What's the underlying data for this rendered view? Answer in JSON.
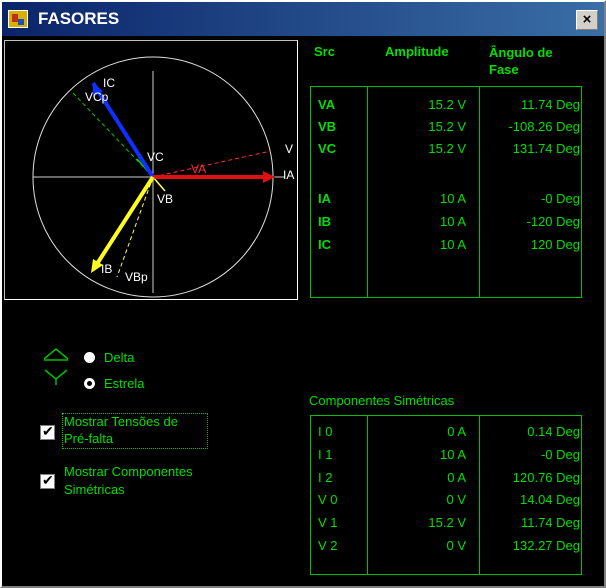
{
  "window": {
    "title": "FASORES",
    "close": "×"
  },
  "phasor_labels": {
    "ic": "IC",
    "vcp": "VCp",
    "vc": "VC",
    "va": "VA",
    "va_edge": "V",
    "ia": "IA",
    "vb": "VB",
    "ib": "IB",
    "vbp": "VBp"
  },
  "table": {
    "headers": {
      "src": "Src",
      "amplitude": "Amplitude",
      "angle": "Ângulo de Fase"
    },
    "rows": [
      {
        "src": "VA",
        "amp": "15.2 V",
        "angle": "11.74  Deg"
      },
      {
        "src": "VB",
        "amp": "15.2 V",
        "angle": "-108.26  Deg"
      },
      {
        "src": "VC",
        "amp": "15.2 V",
        "angle": "131.74  Deg"
      },
      {
        "src": "IA",
        "amp": "10 A",
        "angle": "-0  Deg"
      },
      {
        "src": "IB",
        "amp": "10 A",
        "angle": "-120  Deg"
      },
      {
        "src": "IC",
        "amp": "10 A",
        "angle": "120  Deg"
      }
    ]
  },
  "connection": {
    "delta": "Delta",
    "estrela": "Estrela",
    "selected": "Delta"
  },
  "options": {
    "prefault": {
      "label_line1": "Mostrar Tensões de",
      "label_line2": "Pré-falta",
      "checked": true
    },
    "symmetric": {
      "label_line1": "Mostrar Componentes",
      "label_line2": "Simétricas",
      "checked": true
    }
  },
  "symmetric": {
    "title": "Componentes Simétricas",
    "rows": [
      {
        "src": "I 0",
        "amp": "0 A",
        "angle": "0.14  Deg"
      },
      {
        "src": "I 1",
        "amp": "10 A",
        "angle": "-0  Deg"
      },
      {
        "src": "I 2",
        "amp": "0 A",
        "angle": "120.76  Deg"
      },
      {
        "src": "V 0",
        "amp": "0 V",
        "angle": "14.04  Deg"
      },
      {
        "src": "V 1",
        "amp": "15.2 V",
        "angle": "11.74  Deg"
      },
      {
        "src": "V 2",
        "amp": "0 V",
        "angle": "132.27  Deg"
      }
    ]
  }
}
